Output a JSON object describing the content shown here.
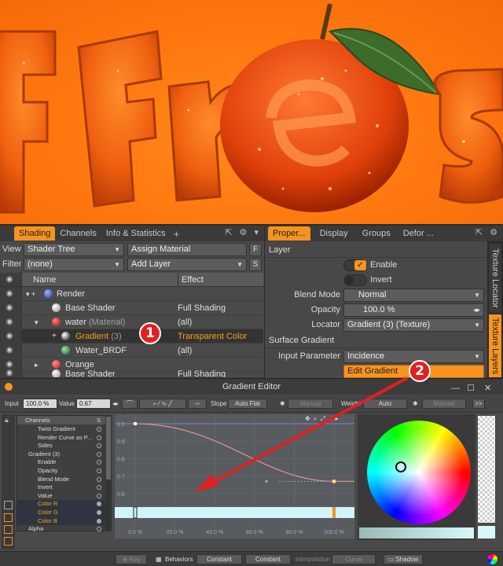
{
  "shading_panel": {
    "tabs": [
      "Shading",
      "Channels",
      "Info & Statistics"
    ],
    "view_label": "View",
    "view_value": "Shader Tree",
    "assign_material": "Assign Material",
    "f_key": "F",
    "filter_label": "Filter",
    "filter_value": "(none)",
    "add_layer": "Add Layer",
    "s_key": "S",
    "col_name": "Name",
    "col_effect": "Effect",
    "rows": [
      {
        "name": "Render",
        "suffix": "",
        "effect": ""
      },
      {
        "name": "Base Shader",
        "suffix": "",
        "effect": "Full Shading"
      },
      {
        "name": "water",
        "suffix": "(Material)",
        "effect": "(all)"
      },
      {
        "name": "Gradient",
        "suffix": "(3)",
        "effect": "Transparent Color"
      },
      {
        "name": "Water_BRDF",
        "suffix": "",
        "effect": "(all)"
      },
      {
        "name": "Orange",
        "suffix": "",
        "effect": ""
      },
      {
        "name": "Base Shader",
        "suffix": "",
        "effect": "Full Shading"
      }
    ]
  },
  "properties_panel": {
    "tabs": [
      "Proper...",
      "Display",
      "Groups",
      "Defor ..."
    ],
    "section_layer": "Layer",
    "enable": "Enable",
    "invert": "Invert",
    "blend_mode_label": "Blend Mode",
    "blend_mode_value": "Normal",
    "opacity_label": "Opacity",
    "opacity_value": "100.0 %",
    "locator_label": "Locator",
    "locator_value": "Gradient (3) (Texture)",
    "section_gradient": "Surface Gradient",
    "input_param_label": "Input Parameter",
    "input_param_value": "Incidence",
    "edit_gradient": "Edit Gradient",
    "side_tabs": [
      "Texture Locator",
      "Texture Layers"
    ]
  },
  "callouts": [
    "1",
    "2"
  ],
  "gradient_editor": {
    "title": "Gradient Editor",
    "input_label": "Input",
    "input_value": "100.0 %",
    "value_label": "Value",
    "value_value": "0.67",
    "slope_label": "Slope",
    "slope_value": "Auto Flat",
    "slope_manual": "Manual",
    "weight_label": "Weight",
    "weight_value": "Auto",
    "weight_manual": "Manual",
    "more": ">>",
    "channels_header": "Channels",
    "channels_s": "S",
    "channels": [
      {
        "label": "Twist Gradient",
        "indent": 1,
        "color": false
      },
      {
        "label": "Render Curve as P...",
        "indent": 1,
        "color": false
      },
      {
        "label": "Sides",
        "indent": 1,
        "color": false
      },
      {
        "label": "Gradient (3)",
        "indent": 0,
        "color": false
      },
      {
        "label": "Enable",
        "indent": 1,
        "color": false
      },
      {
        "label": "Opacity",
        "indent": 1,
        "color": false
      },
      {
        "label": "Blend Mode",
        "indent": 1,
        "color": false
      },
      {
        "label": "Invert",
        "indent": 1,
        "color": false
      },
      {
        "label": "Value",
        "indent": 1,
        "color": false
      },
      {
        "label": "Color R",
        "indent": 1,
        "color": true
      },
      {
        "label": "Color G",
        "indent": 1,
        "color": true
      },
      {
        "label": "Color B",
        "indent": 1,
        "color": true
      },
      {
        "label": "Alpha",
        "indent": 0,
        "color": false
      }
    ],
    "y_ticks": [
      "1.0",
      "0.9",
      "0.8",
      "0.7",
      "0.6"
    ],
    "x_ticks": [
      "0.0 %",
      "20.0 %",
      "40.0 %",
      "60.0 %",
      "80.0 %",
      "100.0 %"
    ],
    "bottom": {
      "key": "Key",
      "behaviors": "Behaviors",
      "constant1": "Constant",
      "constant2": "Constant",
      "interpolation": "Interpolation",
      "curve": "Curve",
      "shadow": "Shadow"
    }
  },
  "colors": {
    "accent": "#f7931e",
    "callout": "#e02020",
    "render_orange": "#ff7a10"
  }
}
